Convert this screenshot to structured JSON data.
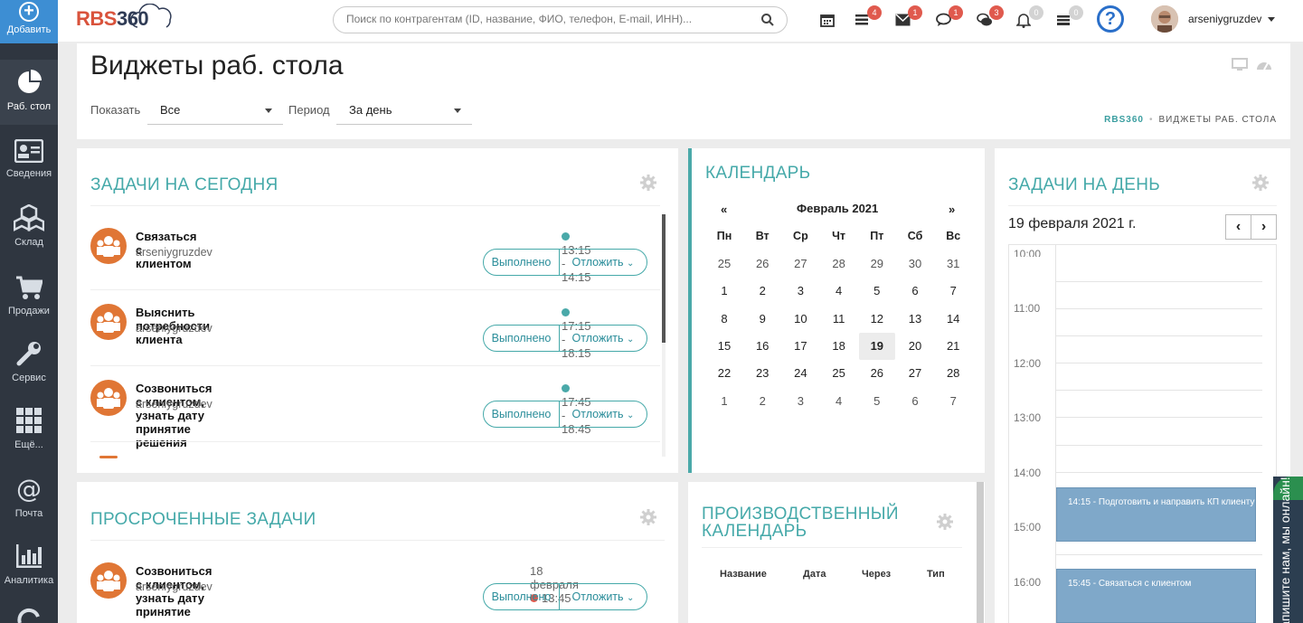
{
  "sidebar": {
    "add_label": "Добавить",
    "items": [
      {
        "label": "Раб. стол",
        "icon": "pie-chart-icon"
      },
      {
        "label": "Сведения",
        "icon": "id-card-icon"
      },
      {
        "label": "Склад",
        "icon": "cubes-icon"
      },
      {
        "label": "Продажи",
        "icon": "cart-icon"
      },
      {
        "label": "Сервис",
        "icon": "wrench-icon"
      },
      {
        "label": "Ещё...",
        "icon": "grid-icon"
      },
      {
        "label": "Почта",
        "icon": "at-icon"
      },
      {
        "label": "Аналитика",
        "icon": "bar-chart-icon"
      }
    ]
  },
  "topbar": {
    "logo_rbs": "RBS",
    "logo_num": "360",
    "search_placeholder": "Поиск по контрагентам (ID, название, ФИО, телефон, E-mail, ИНН)...",
    "badges": {
      "list": "4",
      "mail": "1",
      "chat": "1",
      "comments": "3",
      "bell": "0",
      "inbox": "0"
    },
    "help": "?",
    "username": "arseniygruzdev"
  },
  "header": {
    "title": "Виджеты раб. стола",
    "show_label": "Показать",
    "show_value": "Все",
    "period_label": "Период",
    "period_value": "За день",
    "breadcrumb_home": "RBS360",
    "breadcrumb_current": "ВИДЖЕТЫ РАБ. СТОЛА"
  },
  "tasks_today": {
    "title": "ЗАДАЧИ НА СЕГОДНЯ",
    "done_label": "Выполнено",
    "postpone_label": "Отложить",
    "items": [
      {
        "title": "Связаться с клиентом",
        "user": "arseniygruzdev",
        "time": "13:15 - 14:15"
      },
      {
        "title": "Выяснить потребности клиента",
        "user": "arseniygruzdev",
        "time": "17:15 - 18:15"
      },
      {
        "title": "Созвониться с клиентом, узнать дату принятие решения",
        "user": "arseniygruzdev",
        "time": "17:45 - 18:45"
      }
    ]
  },
  "overdue": {
    "title": "ПРОСРОЧЕННЫЕ ЗАДАЧИ",
    "items": [
      {
        "title": "Созвониться с клиентом, узнать дату принятие решения",
        "user": "arseniygruzdev",
        "date": "18 февраля",
        "time": "13:45"
      }
    ]
  },
  "calendar": {
    "title": "КАЛЕНДАРЬ",
    "prev": "«",
    "next": "»",
    "month": "Февраль 2021",
    "weekdays": [
      "Пн",
      "Вт",
      "Ср",
      "Чт",
      "Пт",
      "Сб",
      "Вс"
    ],
    "weeks": [
      [
        "25",
        "26",
        "27",
        "28",
        "29",
        "30",
        "31"
      ],
      [
        "1",
        "2",
        "3",
        "4",
        "5",
        "6",
        "7"
      ],
      [
        "8",
        "9",
        "10",
        "11",
        "12",
        "13",
        "14"
      ],
      [
        "15",
        "16",
        "17",
        "18",
        "19",
        "20",
        "21"
      ],
      [
        "22",
        "23",
        "24",
        "25",
        "26",
        "27",
        "28"
      ],
      [
        "1",
        "2",
        "3",
        "4",
        "5",
        "6",
        "7"
      ]
    ],
    "today": "19"
  },
  "production_calendar": {
    "title_line1": "ПРОИЗВОДСТВЕННЫЙ",
    "title_line2": "КАЛЕНДАРЬ",
    "columns": [
      "Название",
      "Дата",
      "Через",
      "Тип"
    ]
  },
  "day_tasks": {
    "title": "ЗАДАЧИ НА ДЕНЬ",
    "date": "19 февраля 2021 г.",
    "prev": "‹",
    "next": "›",
    "hours": [
      "10:00",
      "11:00",
      "12:00",
      "13:00",
      "14:00",
      "15:00",
      "16:00"
    ],
    "events": [
      {
        "label": "14:15 - Подготовить и направить КП клиенту"
      },
      {
        "label": "15:45 - Связаться с клиентом"
      }
    ]
  },
  "chat": {
    "label": "Напишите нам, мы онлайн!"
  },
  "colors": {
    "accent": "#45a9a9",
    "sidebar": "#2f3640",
    "add_button": "#3d8ed3",
    "badge": "#e05a4e",
    "avatar": "#e07635"
  }
}
